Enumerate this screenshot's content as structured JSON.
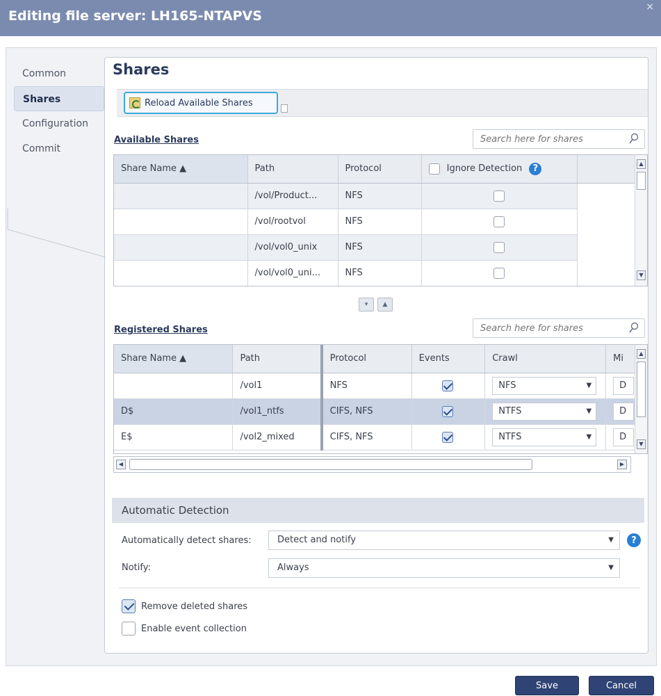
{
  "window": {
    "title": "Editing file server: LH165-NTAPVS",
    "close_glyph": "×"
  },
  "nav": {
    "items": [
      {
        "label": "Common",
        "active": false
      },
      {
        "label": "Shares",
        "active": true
      },
      {
        "label": "Configuration",
        "active": false
      },
      {
        "label": "Commit",
        "active": false
      }
    ]
  },
  "main": {
    "heading": "Shares",
    "toolbar": {
      "reload_label": "Reload Available Shares",
      "reload_icon": "reload-icon"
    }
  },
  "available": {
    "label": "Available Shares",
    "search_placeholder": "Search here for shares",
    "columns": [
      "Share Name ▲",
      "Path",
      "Protocol",
      "Ignore Detection"
    ],
    "rows": [
      {
        "share_name": "",
        "path": "/vol/Product...",
        "protocol": "NFS",
        "ignore": false
      },
      {
        "share_name": "",
        "path": "/vol/rootvol",
        "protocol": "NFS",
        "ignore": false
      },
      {
        "share_name": "",
        "path": "/vol/vol0_unix",
        "protocol": "NFS",
        "ignore": false
      },
      {
        "share_name": "",
        "path": "/vol/vol0_uni...",
        "protocol": "NFS",
        "ignore": false
      }
    ]
  },
  "move_buttons": {
    "down": "▾",
    "up": "▲"
  },
  "registered": {
    "label": "Registered Shares",
    "search_placeholder": "Search here for shares",
    "columns": [
      "Share Name ▲",
      "Path",
      "Protocol",
      "Events",
      "Crawl",
      "Mi"
    ],
    "rows": [
      {
        "share_name": "",
        "path": "/vol1",
        "protocol": "NFS",
        "events": true,
        "crawl": "NFS",
        "mi": "D"
      },
      {
        "share_name": "D$",
        "path": "/vol1_ntfs",
        "protocol": "CIFS, NFS",
        "events": true,
        "crawl": "NTFS",
        "mi": "D",
        "selected": true
      },
      {
        "share_name": "E$",
        "path": "/vol2_mixed",
        "protocol": "CIFS, NFS",
        "events": true,
        "crawl": "NTFS",
        "mi": "D"
      }
    ]
  },
  "auto_detection": {
    "header": "Automatic Detection",
    "detect_label": "Automatically detect shares:",
    "detect_value": "Detect and notify",
    "notify_label": "Notify:",
    "notify_value": "Always",
    "remove_deleted": {
      "label": "Remove deleted shares",
      "checked": true
    },
    "enable_events": {
      "label": "Enable event collection",
      "checked": false
    }
  },
  "footer": {
    "save": "Save",
    "cancel": "Cancel"
  },
  "colors": {
    "title_bar": "#7b8bb0",
    "accent": "#2f4475",
    "selected_row": "#c9d3e4"
  }
}
